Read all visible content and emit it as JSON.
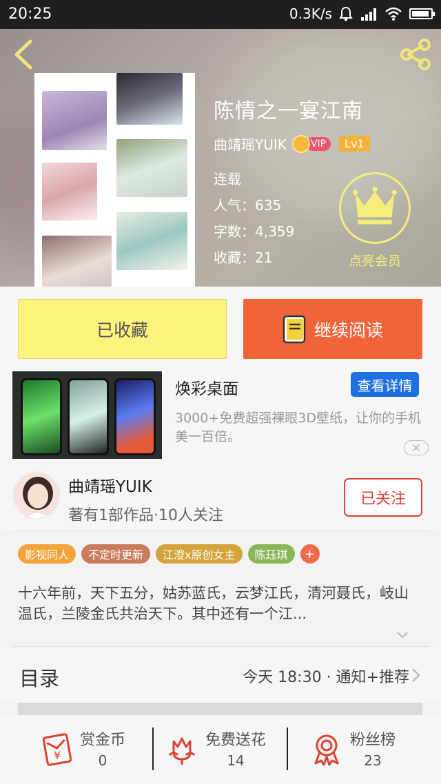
{
  "status_bar": {
    "time": "20:25",
    "network_speed": "0.3K/s"
  },
  "book": {
    "title": "陈情之一宴江南",
    "author": "曲靖瑶YUIK",
    "vip_label": "VIP",
    "level": "Lv1",
    "status": "连载",
    "popularity": "人气：635",
    "word_count": "字数：4,359",
    "favorites": "收藏：21"
  },
  "vip_member": {
    "label": "点亮会员"
  },
  "actions": {
    "favorited_label": "已收藏",
    "continue_label": "继续阅读"
  },
  "ad": {
    "title": "焕彩桌面",
    "button": "查看详情",
    "description": "3000+免费超强裸眼3D壁纸，让你的手机美一百倍。"
  },
  "author_row": {
    "name": "曲靖瑶YUIK",
    "stats": "著有1部作品·10人关注",
    "follow_label": "已关注"
  },
  "tags": [
    {
      "label": "影视同人",
      "color": "#f0a43a"
    },
    {
      "label": "不定时更新",
      "color": "#c97c5d"
    },
    {
      "label": "江澄x原创女主",
      "color": "#d4a33c"
    },
    {
      "label": "陈珏琪",
      "color": "#8ab65a"
    }
  ],
  "tag_add": "+",
  "summary": "十六年前，天下五分，姑苏蓝氏，云梦江氏，清河聂氏，岐山温氏，兰陵金氏共治天下。其中还有一个江...",
  "catalog": {
    "label": "目录",
    "update": "今天 18:30 · 通知+推荐"
  },
  "bottom_bar": [
    {
      "label": "赏金币",
      "value": "0",
      "icon": "coin-envelope-icon"
    },
    {
      "label": "免费送花",
      "value": "14",
      "icon": "flower-icon"
    },
    {
      "label": "粉丝榜",
      "value": "23",
      "icon": "medal-icon"
    }
  ],
  "colors": {
    "accent_orange": "#f0643a",
    "favorited_yellow": "#fdf27c",
    "follow_red": "#d94133",
    "ad_blue": "#1e6fe0",
    "vip_yellow": "#f6ec7a"
  }
}
